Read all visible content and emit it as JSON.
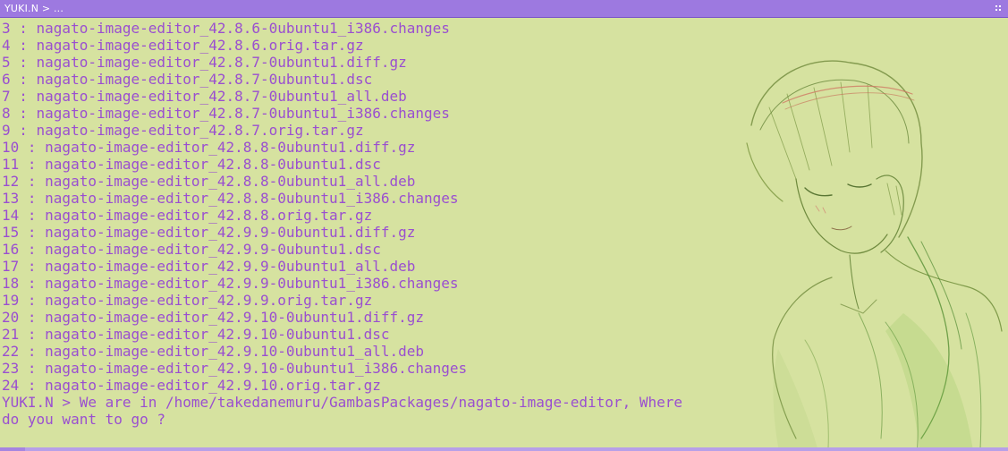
{
  "window": {
    "title": "YUKI.N > ..."
  },
  "terminal": {
    "lines": [
      "3 : nagato-image-editor_42.8.6-0ubuntu1_i386.changes",
      "4 : nagato-image-editor_42.8.6.orig.tar.gz",
      "5 : nagato-image-editor_42.8.7-0ubuntu1.diff.gz",
      "6 : nagato-image-editor_42.8.7-0ubuntu1.dsc",
      "7 : nagato-image-editor_42.8.7-0ubuntu1_all.deb",
      "8 : nagato-image-editor_42.8.7-0ubuntu1_i386.changes",
      "9 : nagato-image-editor_42.8.7.orig.tar.gz",
      "10 : nagato-image-editor_42.8.8-0ubuntu1.diff.gz",
      "11 : nagato-image-editor_42.8.8-0ubuntu1.dsc",
      "12 : nagato-image-editor_42.8.8-0ubuntu1_all.deb",
      "13 : nagato-image-editor_42.8.8-0ubuntu1_i386.changes",
      "14 : nagato-image-editor_42.8.8.orig.tar.gz",
      "15 : nagato-image-editor_42.9.9-0ubuntu1.diff.gz",
      "16 : nagato-image-editor_42.9.9-0ubuntu1.dsc",
      "17 : nagato-image-editor_42.9.9-0ubuntu1_all.deb",
      "18 : nagato-image-editor_42.9.9-0ubuntu1_i386.changes",
      "19 : nagato-image-editor_42.9.9.orig.tar.gz",
      "20 : nagato-image-editor_42.9.10-0ubuntu1.diff.gz",
      "21 : nagato-image-editor_42.9.10-0ubuntu1.dsc",
      "22 : nagato-image-editor_42.9.10-0ubuntu1_all.deb",
      "23 : nagato-image-editor_42.9.10-0ubuntu1_i386.changes",
      "24 : nagato-image-editor_42.9.10.orig.tar.gz"
    ],
    "prompt": "YUKI.N > We are in /home/takedanemuru/GambasPackages/nagato-image-editor, Where\ndo you want to go ?"
  },
  "colors": {
    "background": "#d6e2a0",
    "text": "#9a4fd0",
    "titlebar": "#9d79e0"
  },
  "icons": {
    "grip": "grip-dots-icon",
    "illustration": "sketch-character-illustration"
  }
}
